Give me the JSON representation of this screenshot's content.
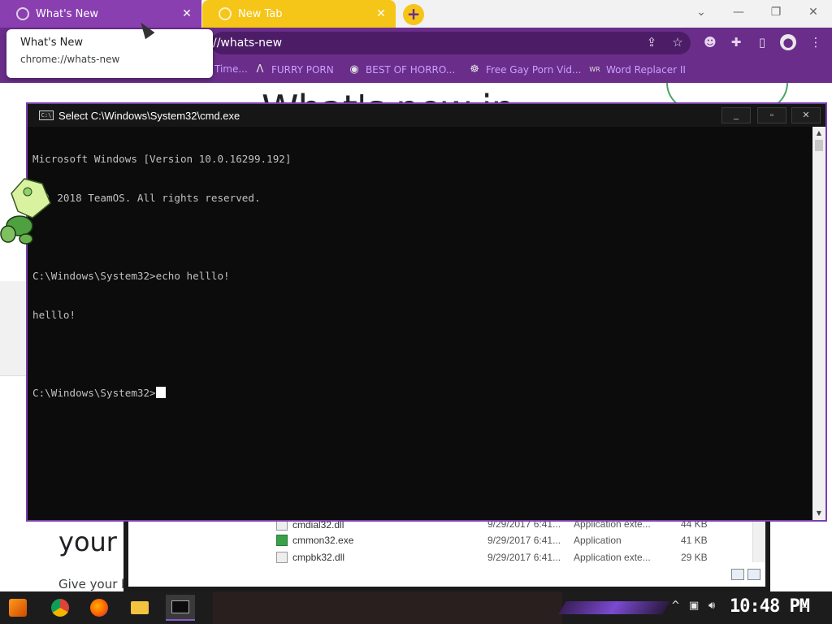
{
  "browser": {
    "tabs": [
      {
        "title": "What's New",
        "active": true
      },
      {
        "title": "New Tab",
        "active": false
      }
    ],
    "newtab_symbol": "+",
    "tooltip": {
      "title": "What's New",
      "url": "chrome://whats-new"
    },
    "omnibox_text": "//whats-new",
    "bookmarks": [
      {
        "label": "Time...",
        "icon": ""
      },
      {
        "label": "FURRY PORN",
        "icon": "Λ"
      },
      {
        "label": "BEST OF HORRO...",
        "icon": "◉"
      },
      {
        "label": "Free Gay Porn Vid...",
        "icon": "☸"
      },
      {
        "label": "Word Replacer II",
        "icon": "WR"
      }
    ],
    "page": {
      "heading": "What's new in",
      "section_heading": "your",
      "section_text": "Give your b"
    }
  },
  "cmd": {
    "title": "Select C:\\Windows\\System32\\cmd.exe",
    "lines": [
      "Microsoft Windows [Version 10.0.16299.192]",
      "(c) 2018 TeamOS. All rights reserved.",
      "",
      "C:\\Windows\\System32>echo helllo!",
      "helllo!",
      "",
      "C:\\Windows\\System32>"
    ]
  },
  "explorer": {
    "rows": [
      {
        "name": "cmdial32.dll",
        "date": "9/29/2017 6:41...",
        "type": "Application exte...",
        "size": "44 KB"
      },
      {
        "name": "cmmon32.exe",
        "date": "9/29/2017 6:41...",
        "type": "Application",
        "size": "41 KB"
      },
      {
        "name": "cmpbk32.dll",
        "date": "9/29/2017 6:41...",
        "type": "Application exte...",
        "size": "29 KB"
      }
    ]
  },
  "taskbar": {
    "clock": "10:48 PM",
    "apps": [
      "start",
      "chrome",
      "firefox",
      "file-explorer",
      "cmd"
    ]
  },
  "colors": {
    "chrome_purple": "#6a2d8a",
    "tab_yellow": "#f5c518",
    "bookmark_text": "#c9a0ff",
    "console_bg": "#0c0c0c",
    "console_text": "#c0c0c0"
  }
}
